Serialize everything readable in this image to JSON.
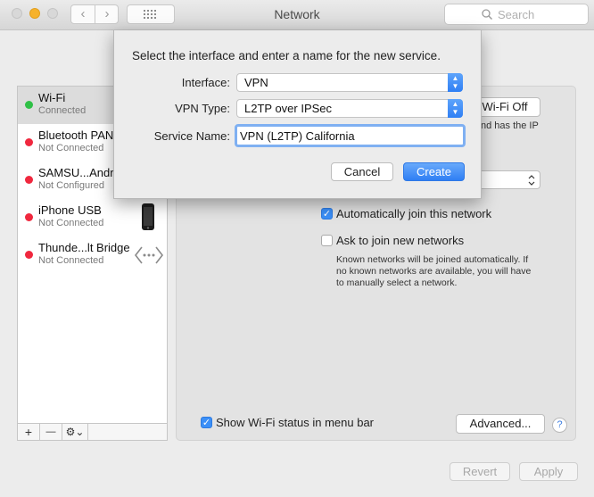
{
  "window": {
    "title": "Network"
  },
  "toolbar": {
    "search_placeholder": "Search"
  },
  "services": [
    {
      "name": "Wi-Fi",
      "status": "Connected",
      "status_color": "#2fc046"
    },
    {
      "name": "Bluetooth PAN",
      "status": "Not Connected",
      "status_color": "#f0283e"
    },
    {
      "name": "SAMSU...Android",
      "status": "Not Configured",
      "status_color": "#f0283e"
    },
    {
      "name": "iPhone USB",
      "status": "Not Connected",
      "status_color": "#f0283e"
    },
    {
      "name": "Thunde...lt Bridge",
      "status": "Not Connected",
      "status_color": "#f0283e"
    }
  ],
  "sidebar_buttons": {
    "add": "+",
    "remove": "—",
    "gear": "⚙⌄"
  },
  "panel": {
    "wifi_off_button": "Wi-Fi Off",
    "status_desc_fragment": "nd has the IP",
    "auto_join_label": "Automatically join this network",
    "auto_join_checked": true,
    "ask_join_label": "Ask to join new networks",
    "ask_join_checked": false,
    "ask_join_help_1": "Known networks will be joined automatically. If",
    "ask_join_help_2": "no known networks are available, you will have",
    "ask_join_help_3": "to manually select a network.",
    "show_status_label": "Show Wi-Fi status in menu bar",
    "show_status_checked": true,
    "advanced_button": "Advanced...",
    "help_button": "?"
  },
  "footer": {
    "revert_button": "Revert",
    "apply_button": "Apply"
  },
  "dialog": {
    "prompt": "Select the interface and enter a name for the new service.",
    "interface_label": "Interface:",
    "interface_value": "VPN",
    "vpn_type_label": "VPN Type:",
    "vpn_type_value": "L2TP over IPSec",
    "service_name_label": "Service Name:",
    "service_name_value": "VPN (L2TP) California",
    "cancel_button": "Cancel",
    "create_button": "Create"
  },
  "colors": {
    "accent": "#3b8ff7"
  }
}
